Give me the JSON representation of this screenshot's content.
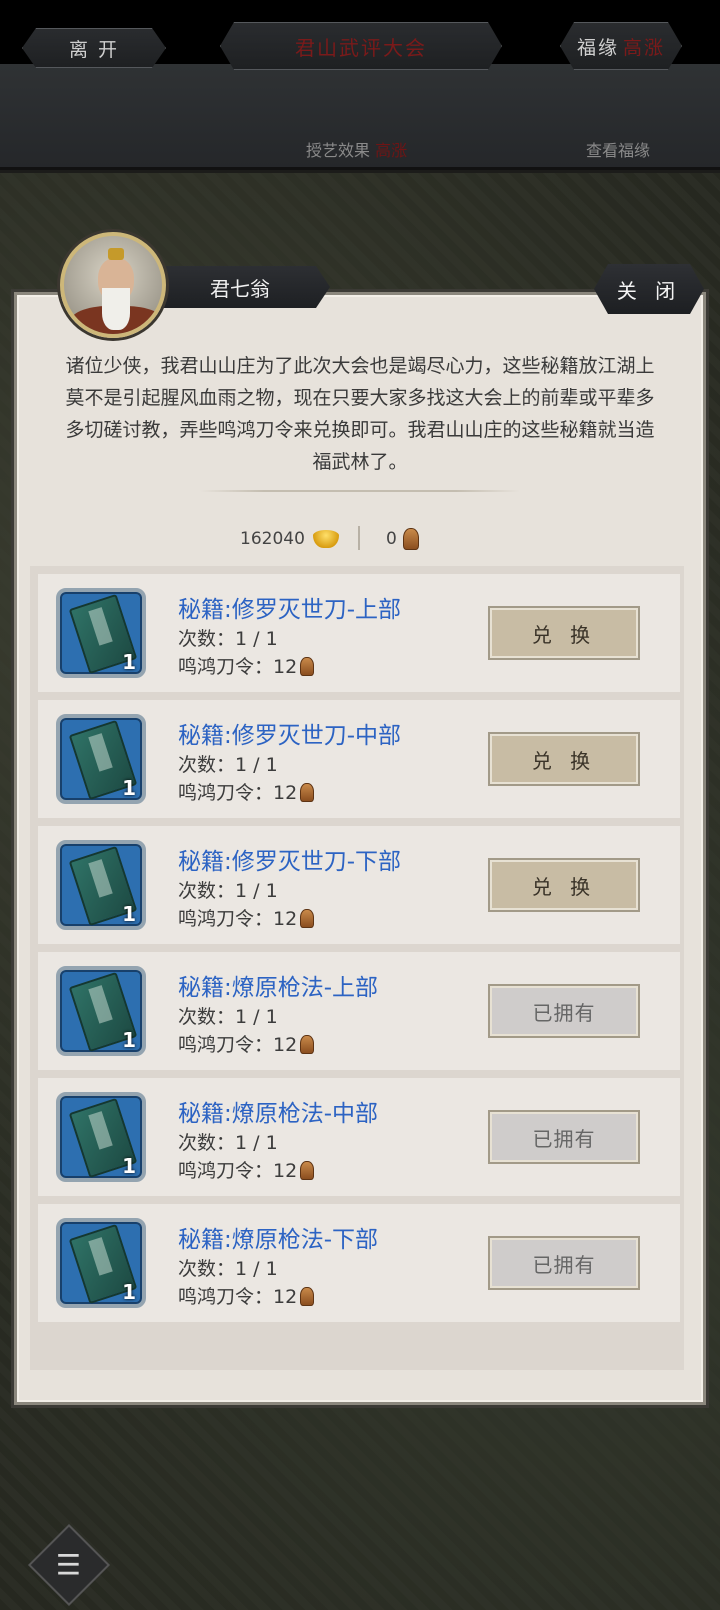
{
  "header": {
    "leave_label": "离 开",
    "event_title": "君山武评大会",
    "fortune_label": "福缘",
    "fortune_value": "高涨",
    "skill_effect_label": "授艺效果",
    "skill_effect_value": "高涨",
    "view_fortune_label": "查看福缘"
  },
  "dialog": {
    "npc_name": "君七翁",
    "close_label": "关 闭",
    "intro_text": "诸位少侠，我君山山庄为了此次大会也是竭尽心力，这些秘籍放江湖上莫不是引起腥风血雨之物，现在只要大家多找这大会上的前辈或平辈多多切磋讨教，弄些鸣鸿刀令来兑换即可。我君山山庄的这些秘籍就当造福武林了。",
    "gold_amount": "162040",
    "token_amount": "0"
  },
  "items": [
    {
      "title": "秘籍:修罗灭世刀-上部",
      "count": "次数：1 / 1",
      "cost": "鸣鸿刀令：12",
      "qty": "1",
      "action": "兑 换"
    },
    {
      "title": "秘籍:修罗灭世刀-中部",
      "count": "次数：1 / 1",
      "cost": "鸣鸿刀令：12",
      "qty": "1",
      "action": "兑 换"
    },
    {
      "title": "秘籍:修罗灭世刀-下部",
      "count": "次数：1 / 1",
      "cost": "鸣鸿刀令：12",
      "qty": "1",
      "action": "兑 换"
    },
    {
      "title": "秘籍:燎原枪法-上部",
      "count": "次数：1 / 1",
      "cost": "鸣鸿刀令：12",
      "qty": "1",
      "action": "已拥有"
    },
    {
      "title": "秘籍:燎原枪法-中部",
      "count": "次数：1 / 1",
      "cost": "鸣鸿刀令：12",
      "qty": "1",
      "action": "已拥有"
    },
    {
      "title": "秘籍:燎原枪法-下部",
      "count": "次数：1 / 1",
      "cost": "鸣鸿刀令：12",
      "qty": "1",
      "action": "已拥有"
    }
  ],
  "colors": {
    "accent_blue": "#2c63c3",
    "highlight_red": "#7a1a1a"
  }
}
